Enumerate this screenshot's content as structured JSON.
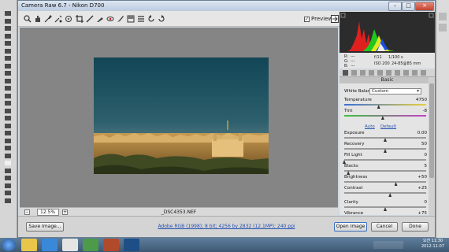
{
  "window": {
    "title": "Camera Raw 6.7  -  Nikon D700"
  },
  "titlebar_buttons": {
    "minimize": "–",
    "maximize": "□",
    "close": "×"
  },
  "toolbar": {
    "preview_label": "Preview",
    "preview_checked": true
  },
  "canvas": {
    "zoom": "12.5%",
    "zoom_minus": "–",
    "zoom_plus": "+",
    "filename": "_DSC4353.NEF"
  },
  "readout": {
    "r_label": "R:",
    "g_label": "G:",
    "b_label": "B:",
    "r_value": "---",
    "g_value": "---",
    "b_value": "---",
    "aperture": "f/11",
    "shutter": "1/100 s",
    "iso": "ISO 200",
    "lens": "24-85@85 mm"
  },
  "panel": {
    "title": "Basic",
    "white_balance_label": "White Balance:",
    "white_balance_value": "Custom",
    "auto_label": "Auto",
    "default_label": "Default",
    "sliders": [
      {
        "label": "Temperature",
        "value": "4750",
        "level": 0.42
      },
      {
        "label": "Tint",
        "value": "-8",
        "level": 0.47
      },
      {
        "label": "Exposure",
        "value": "0.00",
        "level": 0.5
      },
      {
        "label": "Recovery",
        "value": "50",
        "level": 0.5
      },
      {
        "label": "Fill Light",
        "value": "0",
        "level": 0.0
      },
      {
        "label": "Blacks",
        "value": "5",
        "level": 0.05
      },
      {
        "label": "Brightness",
        "value": "+50",
        "level": 0.63
      },
      {
        "label": "Contrast",
        "value": "+25",
        "level": 0.56
      },
      {
        "label": "Clarity",
        "value": "0",
        "level": 0.5
      },
      {
        "label": "Vibrance",
        "value": "+75",
        "level": 0.87
      }
    ]
  },
  "bottom": {
    "save_image": "Save Image...",
    "workflow": "Adobe RGB (1998); 8 bit; 4256 by 2832 (12.1MP); 240 ppi",
    "open_image": "Open Image",
    "cancel": "Cancel",
    "done": "Done"
  },
  "taskbar": {
    "time": "오전 11:30",
    "date": "2012-11-07"
  },
  "colors": {
    "accent": "#2350b0",
    "canvas": "#858585",
    "taskbar": "#4a6884"
  },
  "icons": [
    "zoom-icon",
    "hand-icon",
    "white-balance-icon",
    "color-sampler-icon",
    "target-adjust-icon",
    "crop-icon",
    "straighten-icon",
    "spot-removal-icon",
    "red-eye-icon",
    "adjustment-brush-icon",
    "graduated-filter-icon",
    "preferences-icon",
    "rotate-ccw-icon",
    "rotate-cw-icon",
    "fullscreen-icon"
  ]
}
